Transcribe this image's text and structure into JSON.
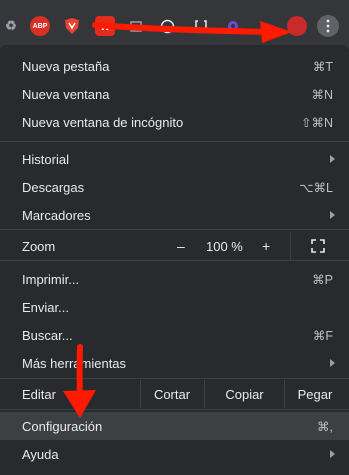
{
  "toolbar": {
    "extensions": [
      {
        "name": "recycle-icon",
        "text": "♻"
      },
      {
        "name": "adblock-plus-icon",
        "text": "ABP"
      },
      {
        "name": "brave-shield-icon",
        "text": ""
      },
      {
        "name": "w-extension-icon",
        "text": "w"
      },
      {
        "name": "puzzle-icon",
        "text": ""
      },
      {
        "name": "globe-icon",
        "text": ""
      },
      {
        "name": "bracket-icon",
        "text": ""
      },
      {
        "name": "gear-extension-icon",
        "text": ""
      }
    ],
    "menu_button_icon": "three-dots-vertical-icon"
  },
  "menu": {
    "group1": [
      {
        "label": "Nueva pestaña",
        "shortcut": "⌘T"
      },
      {
        "label": "Nueva ventana",
        "shortcut": "⌘N"
      },
      {
        "label": "Nueva ventana de incógnito",
        "shortcut": "⇧⌘N"
      }
    ],
    "group2": [
      {
        "label": "Historial",
        "shortcut": ""
      },
      {
        "label": "Descargas",
        "shortcut": "⌥⌘L"
      },
      {
        "label": "Marcadores",
        "shortcut": ""
      }
    ],
    "zoom": {
      "label": "Zoom",
      "minus": "–",
      "value": "100 %",
      "plus": "+"
    },
    "group3": [
      {
        "label": "Imprimir...",
        "shortcut": "⌘P"
      },
      {
        "label": "Enviar...",
        "shortcut": ""
      },
      {
        "label": "Buscar...",
        "shortcut": "⌘F"
      },
      {
        "label": "Más herramientas",
        "shortcut": ""
      }
    ],
    "edit": {
      "label": "Editar",
      "cut": "Cortar",
      "copy": "Copiar",
      "paste": "Pegar"
    },
    "settings": {
      "label": "Configuración",
      "shortcut": "⌘,"
    },
    "help": {
      "label": "Ayuda",
      "shortcut": ""
    }
  },
  "annotation_color": "#ff1a00"
}
